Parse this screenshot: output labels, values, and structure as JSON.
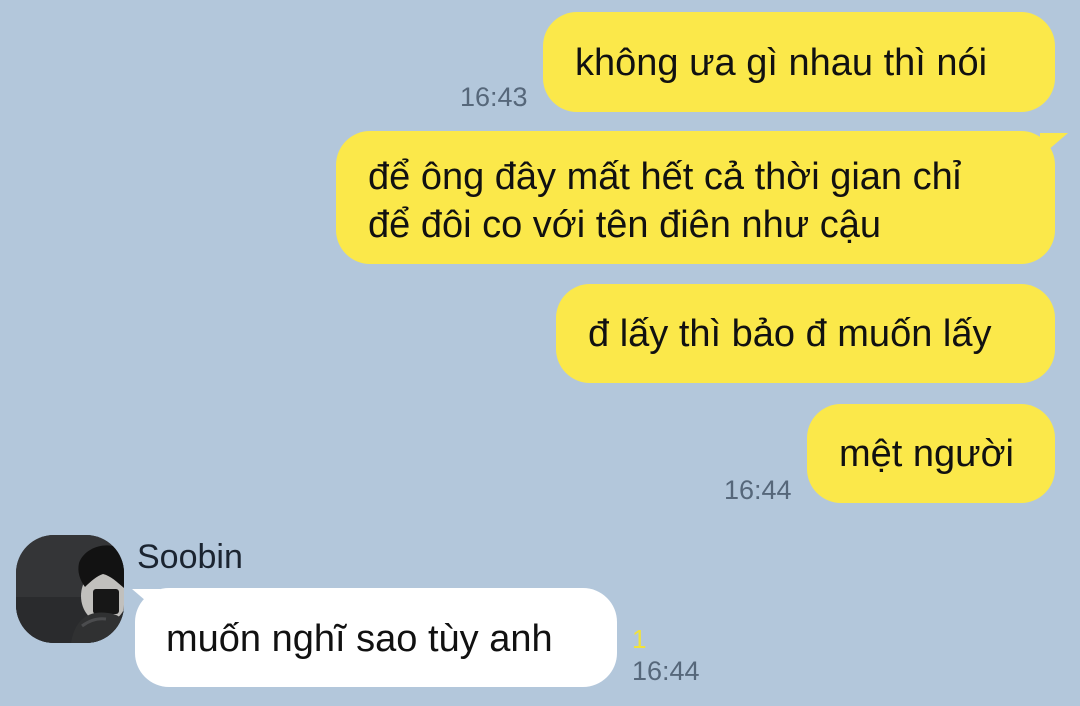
{
  "chat": {
    "messages": [
      {
        "text": "không ưa gì nhau thì nói",
        "time": "16:43",
        "direction": "outgoing"
      },
      {
        "lines": [
          "để ông đây mất hết cả thời gian chỉ",
          "để đôi co với tên điên như cậu"
        ],
        "direction": "outgoing"
      },
      {
        "text": "đ lấy thì bảo đ muốn lấy",
        "direction": "outgoing"
      },
      {
        "text": "mệt người",
        "time": "16:44",
        "direction": "outgoing"
      },
      {
        "sender": "Soobin",
        "text": "muốn nghĩ sao tùy anh",
        "read_count": "1",
        "time": "16:44",
        "direction": "incoming"
      }
    ]
  },
  "theme": {
    "background": "#b3c7db",
    "outgoing_bubble": "#fbe84a",
    "incoming_bubble": "#ffffff",
    "time_color": "#56677a",
    "read_count_color": "#f1e23b"
  }
}
